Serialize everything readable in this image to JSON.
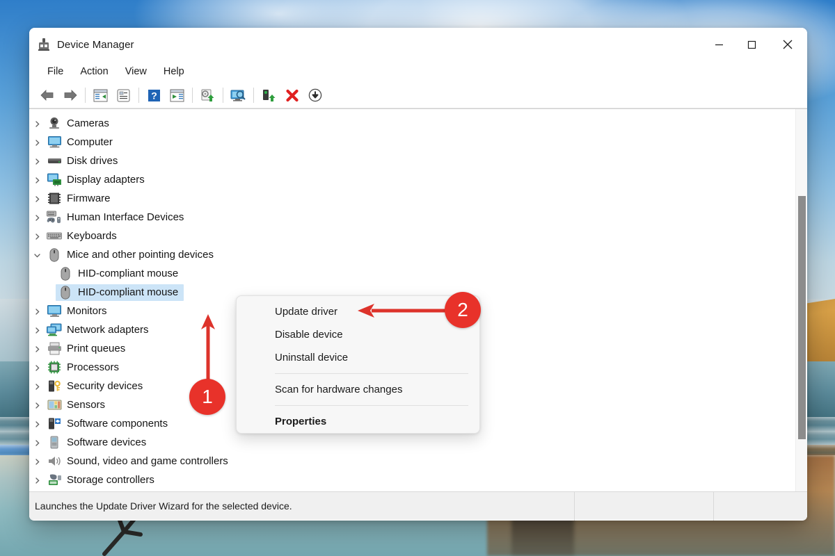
{
  "window": {
    "title": "Device Manager",
    "icon": "device-manager-icon",
    "controls": {
      "minimize": "minimize-icon",
      "maximize": "maximize-icon",
      "close": "close-icon"
    }
  },
  "menubar": {
    "items": [
      {
        "label": "File"
      },
      {
        "label": "Action"
      },
      {
        "label": "View"
      },
      {
        "label": "Help"
      }
    ]
  },
  "toolbar": {
    "buttons": [
      {
        "name": "back-icon"
      },
      {
        "name": "forward-icon"
      },
      {
        "name": "show-hide-console-tree-icon"
      },
      {
        "name": "properties-icon"
      },
      {
        "name": "help-icon"
      },
      {
        "name": "update-driver-icon"
      },
      {
        "name": "scan-for-hardware-changes-icon"
      },
      {
        "name": "display-devices-icon"
      },
      {
        "name": "enable-device-icon"
      },
      {
        "name": "uninstall-device-icon"
      },
      {
        "name": "disable-device-icon"
      }
    ]
  },
  "tree": {
    "items": [
      {
        "label": "Cameras",
        "icon": "camera-icon",
        "level": 0,
        "expanded": false,
        "selected": false
      },
      {
        "label": "Computer",
        "icon": "computer-icon",
        "level": 0,
        "expanded": false,
        "selected": false
      },
      {
        "label": "Disk drives",
        "icon": "disk-drive-icon",
        "level": 0,
        "expanded": false,
        "selected": false
      },
      {
        "label": "Display adapters",
        "icon": "display-adapter-icon",
        "level": 0,
        "expanded": false,
        "selected": false
      },
      {
        "label": "Firmware",
        "icon": "firmware-icon",
        "level": 0,
        "expanded": false,
        "selected": false
      },
      {
        "label": "Human Interface Devices",
        "icon": "hid-icon",
        "level": 0,
        "expanded": false,
        "selected": false
      },
      {
        "label": "Keyboards",
        "icon": "keyboard-icon",
        "level": 0,
        "expanded": false,
        "selected": false
      },
      {
        "label": "Mice and other pointing devices",
        "icon": "mouse-icon",
        "level": 0,
        "expanded": true,
        "selected": false
      },
      {
        "label": "HID-compliant mouse",
        "icon": "mouse-icon",
        "level": 1,
        "expanded": false,
        "selected": false
      },
      {
        "label": "HID-compliant mouse",
        "icon": "mouse-icon",
        "level": 1,
        "expanded": false,
        "selected": true
      },
      {
        "label": "Monitors",
        "icon": "monitor-icon",
        "level": 0,
        "expanded": false,
        "selected": false
      },
      {
        "label": "Network adapters",
        "icon": "network-adapter-icon",
        "level": 0,
        "expanded": false,
        "selected": false
      },
      {
        "label": "Print queues",
        "icon": "printer-icon",
        "level": 0,
        "expanded": false,
        "selected": false
      },
      {
        "label": "Processors",
        "icon": "processor-icon",
        "level": 0,
        "expanded": false,
        "selected": false
      },
      {
        "label": "Security devices",
        "icon": "security-device-icon",
        "level": 0,
        "expanded": false,
        "selected": false
      },
      {
        "label": "Sensors",
        "icon": "sensor-icon",
        "level": 0,
        "expanded": false,
        "selected": false
      },
      {
        "label": "Software components",
        "icon": "software-component-icon",
        "level": 0,
        "expanded": false,
        "selected": false
      },
      {
        "label": "Software devices",
        "icon": "software-device-icon",
        "level": 0,
        "expanded": false,
        "selected": false
      },
      {
        "label": "Sound, video and game controllers",
        "icon": "sound-device-icon",
        "level": 0,
        "expanded": false,
        "selected": false
      },
      {
        "label": "Storage controllers",
        "icon": "storage-controller-icon",
        "level": 0,
        "expanded": false,
        "selected": false
      }
    ]
  },
  "context_menu": {
    "items": [
      {
        "label": "Update driver",
        "bold": false,
        "separator_after": false
      },
      {
        "label": "Disable device",
        "bold": false,
        "separator_after": false
      },
      {
        "label": "Uninstall device",
        "bold": false,
        "separator_after": true
      },
      {
        "label": "Scan for hardware changes",
        "bold": false,
        "separator_after": true
      },
      {
        "label": "Properties",
        "bold": true,
        "separator_after": false
      }
    ]
  },
  "statusbar": {
    "text": "Launches the Update Driver Wizard for the selected device."
  },
  "callouts": [
    {
      "number": "1",
      "points_to": "HID-compliant mouse"
    },
    {
      "number": "2",
      "points_to": "Update driver"
    }
  ],
  "colors": {
    "selection": "#cce4f7",
    "callout": "#e8322a",
    "window_bg": "#ffffff",
    "statusbar_bg": "#f0f0f0",
    "menu_bg": "#f7f7f7"
  }
}
